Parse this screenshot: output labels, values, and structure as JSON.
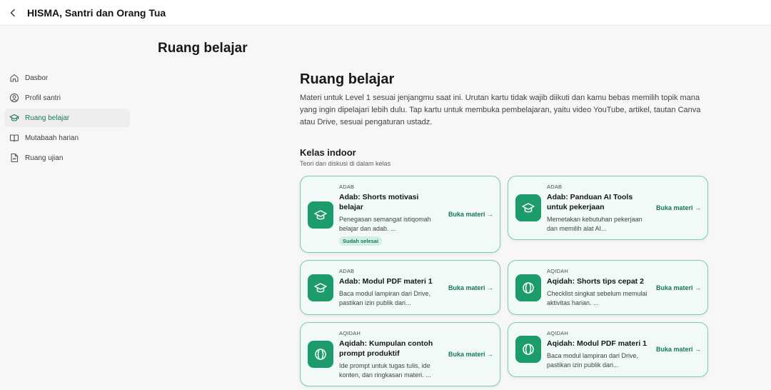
{
  "header": {
    "title": "HISMA, Santri dan Orang Tua"
  },
  "page": {
    "heading": "Ruang belajar"
  },
  "sidebar": {
    "items": [
      {
        "label": "Dasbor",
        "icon": "home-icon",
        "active": false
      },
      {
        "label": "Profil santri",
        "icon": "user-circle-icon",
        "active": false
      },
      {
        "label": "Ruang belajar",
        "icon": "graduation-cap-icon",
        "active": true
      },
      {
        "label": "Mutabaah harian",
        "icon": "book-open-icon",
        "active": false
      },
      {
        "label": "Ruang ujian",
        "icon": "document-icon",
        "active": false
      }
    ]
  },
  "main": {
    "title": "Ruang belajar",
    "description": "Materi untuk Level 1 sesuai jenjangmu saat ini. Urutan kartu tidak wajib diikuti dan kamu bebas memilih topik mana yang ingin dipelajari lebih dulu. Tap kartu untuk membuka pembelajaran, yaitu video YouTube, artikel, tautan Canva atau Drive, sesuai pengaturan ustadz.",
    "section": {
      "title": "Kelas indoor",
      "subtitle": "Teori dan diskusi di dalam kelas"
    },
    "cta_label": "Buka materi →",
    "cards": [
      {
        "category": "ADAB",
        "icon": "graduation-cap-icon",
        "title": "Adab: Shorts motivasi belajar",
        "desc": "Penegasan semangat istiqomah belajar dan adab. ...",
        "badge": "Sudah selesai"
      },
      {
        "category": "ADAB",
        "icon": "graduation-cap-icon",
        "title": "Adab: Panduan AI Tools untuk pekerjaan",
        "desc": "Memetakan kebutuhan pekerjaan dan memilih alat AI...",
        "badge": ""
      },
      {
        "category": "ADAB",
        "icon": "graduation-cap-icon",
        "title": "Adab: Modul PDF materi 1",
        "desc": "Baca modul lampiran dari Drive, pastikan izin publik dari...",
        "badge": ""
      },
      {
        "category": "AQIDAH",
        "icon": "aqidah-emblem-icon",
        "title": "Aqidah: Shorts tips cepat 2",
        "desc": "Checklist singkat sebelum memulai aktivitas harian. ...",
        "badge": ""
      },
      {
        "category": "AQIDAH",
        "icon": "aqidah-emblem-icon",
        "title": "Aqidah: Kumpulan contoh prompt produktif",
        "desc": "Ide prompt untuk tugas tulis, ide konten, dan ringkasan materi. ...",
        "badge": ""
      },
      {
        "category": "AQIDAH",
        "icon": "aqidah-emblem-icon",
        "title": "Aqidah: Modul PDF materi 1",
        "desc": "Baca modul lampiran dari Drive, pastikan izin publik dari...",
        "badge": ""
      }
    ]
  },
  "colors": {
    "accent": "#1c9c6b",
    "accent_text": "#167a50",
    "card_border": "#7ccaa8",
    "card_bg": "#f1faf6"
  }
}
